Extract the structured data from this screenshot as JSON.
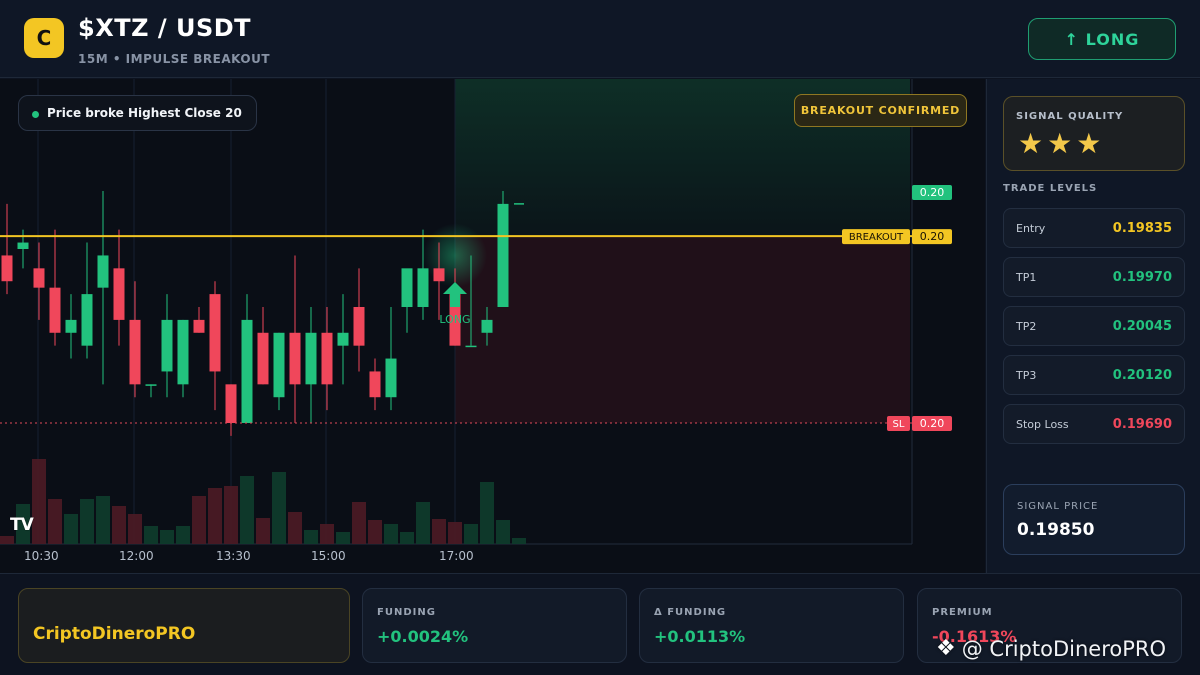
{
  "header": {
    "logo_letter": "C",
    "pair": "$XTZ / USDT",
    "subtitle": "15M • IMPULSE BREAKOUT",
    "direction_button": "↑ LONG"
  },
  "chart": {
    "alert_text": "Price broke Highest Close 20",
    "confirm_badge": "BREAKOUT CONFIRMED",
    "signal_label": "LONG",
    "tv_logo": "TV",
    "price_tags": {
      "top": "0.20",
      "breakout_label": "BREAKOUT",
      "breakout_value": "0.20",
      "sl_label": "SL",
      "sl_value": "0.20"
    },
    "time_labels": [
      "10:30",
      "12:00",
      "13:30",
      "15:00",
      "17:00"
    ],
    "colors": {
      "up": "#22c27e",
      "down": "#f0475b",
      "breakout": "#f3c623"
    }
  },
  "chart_data": {
    "type": "candlestick",
    "candles": [
      {
        "o": 0.1982,
        "h": 0.1986,
        "l": 0.1979,
        "c": 0.198
      },
      {
        "o": 0.19825,
        "h": 0.1984,
        "l": 0.1981,
        "c": 0.1983
      },
      {
        "o": 0.1981,
        "h": 0.1983,
        "l": 0.1977,
        "c": 0.19795
      },
      {
        "o": 0.19795,
        "h": 0.1984,
        "l": 0.1975,
        "c": 0.1976
      },
      {
        "o": 0.1976,
        "h": 0.1979,
        "l": 0.1974,
        "c": 0.1977
      },
      {
        "o": 0.1975,
        "h": 0.1983,
        "l": 0.1974,
        "c": 0.1979
      },
      {
        "o": 0.19795,
        "h": 0.1987,
        "l": 0.1972,
        "c": 0.1982
      },
      {
        "o": 0.1981,
        "h": 0.1984,
        "l": 0.1975,
        "c": 0.1977
      },
      {
        "o": 0.1977,
        "h": 0.198,
        "l": 0.1971,
        "c": 0.1972
      },
      {
        "o": 0.1972,
        "h": 0.1972,
        "l": 0.1971,
        "c": 0.1972
      },
      {
        "o": 0.1973,
        "h": 0.1979,
        "l": 0.1971,
        "c": 0.1977
      },
      {
        "o": 0.1972,
        "h": 0.1977,
        "l": 0.1971,
        "c": 0.1977
      },
      {
        "o": 0.1977,
        "h": 0.1978,
        "l": 0.1976,
        "c": 0.1976
      },
      {
        "o": 0.1979,
        "h": 0.198,
        "l": 0.197,
        "c": 0.1973
      },
      {
        "o": 0.1972,
        "h": 0.1972,
        "l": 0.1968,
        "c": 0.1969
      },
      {
        "o": 0.1969,
        "h": 0.1979,
        "l": 0.1969,
        "c": 0.1977
      },
      {
        "o": 0.1976,
        "h": 0.1978,
        "l": 0.1972,
        "c": 0.1972
      },
      {
        "o": 0.1971,
        "h": 0.1976,
        "l": 0.197,
        "c": 0.1976
      },
      {
        "o": 0.1976,
        "h": 0.1982,
        "l": 0.1969,
        "c": 0.1972
      },
      {
        "o": 0.1972,
        "h": 0.1978,
        "l": 0.1969,
        "c": 0.1976
      },
      {
        "o": 0.1976,
        "h": 0.1978,
        "l": 0.197,
        "c": 0.1972
      },
      {
        "o": 0.1975,
        "h": 0.1979,
        "l": 0.1972,
        "c": 0.1976
      },
      {
        "o": 0.1978,
        "h": 0.1981,
        "l": 0.1973,
        "c": 0.1975
      },
      {
        "o": 0.1973,
        "h": 0.1974,
        "l": 0.197,
        "c": 0.1971
      },
      {
        "o": 0.1971,
        "h": 0.1978,
        "l": 0.197,
        "c": 0.1974
      },
      {
        "o": 0.1978,
        "h": 0.198,
        "l": 0.1976,
        "c": 0.1981
      },
      {
        "o": 0.1978,
        "h": 0.1984,
        "l": 0.1977,
        "c": 0.1981
      },
      {
        "o": 0.1981,
        "h": 0.1983,
        "l": 0.1977,
        "c": 0.198
      },
      {
        "o": 0.1979,
        "h": 0.1981,
        "l": 0.1975,
        "c": 0.1975
      },
      {
        "o": 0.1975,
        "h": 0.1982,
        "l": 0.1975,
        "c": 0.1975
      },
      {
        "o": 0.1976,
        "h": 0.1978,
        "l": 0.1975,
        "c": 0.1977
      },
      {
        "o": 0.1978,
        "h": 0.1987,
        "l": 0.1978,
        "c": 0.1986
      },
      {
        "o": 0.1986,
        "h": 0.1986,
        "l": 0.1986,
        "c": 0.1986
      }
    ],
    "volumes": [
      8,
      40,
      85,
      45,
      30,
      45,
      48,
      38,
      30,
      18,
      14,
      18,
      48,
      56,
      58,
      68,
      26,
      72,
      32,
      14,
      20,
      12,
      42,
      24,
      20,
      12,
      42,
      25,
      22,
      20,
      62,
      24,
      6
    ],
    "breakout_level": 0.19835,
    "stop_loss_level": 0.1969,
    "signal_candle_index": 28,
    "ylim": [
      0.1969,
      0.1987
    ]
  },
  "sidebar": {
    "quality_label": "SIGNAL QUALITY",
    "stars": "★★★",
    "stars_rating": 3,
    "levels_title": "TRADE LEVELS",
    "levels": [
      {
        "label": "Entry",
        "value": "0.19835",
        "color": "#f3c623"
      },
      {
        "label": "TP1",
        "value": "0.19970",
        "color": "#22c27e"
      },
      {
        "label": "TP2",
        "value": "0.20045",
        "color": "#22c27e"
      },
      {
        "label": "TP3",
        "value": "0.20120",
        "color": "#22c27e"
      },
      {
        "label": "Stop Loss",
        "value": "0.19690",
        "color": "#f0475b"
      }
    ],
    "signal_price_label": "SIGNAL PRICE",
    "signal_price": "0.19850"
  },
  "footer": {
    "brand": "CriptoDineroPRO",
    "metrics": [
      {
        "label": "FUNDING",
        "value": "+0.0024%",
        "color": "#22c27e"
      },
      {
        "label": "Δ FUNDING",
        "value": "+0.0113%",
        "color": "#22c27e"
      },
      {
        "label": "PREMIUM",
        "value": "-0.1613%",
        "color": "#f0475b"
      }
    ],
    "watermark": "@ CriptoDineroPRO"
  }
}
